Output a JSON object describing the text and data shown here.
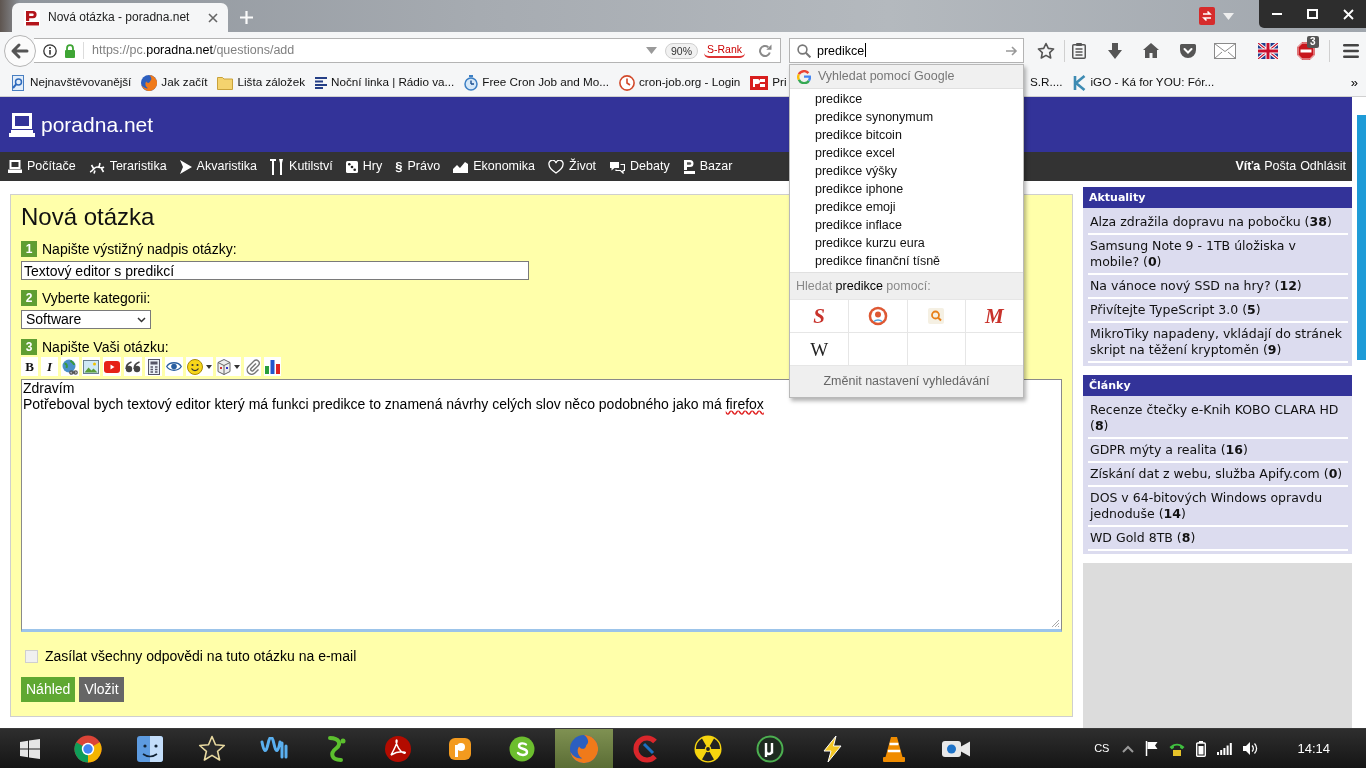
{
  "browser": {
    "tabs": [
      {
        "title": "Nová otázka - poradna.net",
        "selected": true
      }
    ],
    "url": [
      {
        "text": "https://pc.",
        "strong": false
      },
      {
        "text": "poradna.net",
        "strong": true
      },
      {
        "text": "/questions/add",
        "strong": false
      }
    ],
    "zoom": "90%",
    "addon_label": "S-Rank",
    "search_value": "predikce",
    "blocker_badge": "3",
    "bookmarks_left": [
      {
        "label": "Nejnavštěvovanější"
      },
      {
        "label": "Jak začít"
      },
      {
        "label": "Lišta záložek"
      },
      {
        "label": "Noční linka | Rádio va..."
      },
      {
        "label": "Free Cron Job and Mo..."
      },
      {
        "label": "cron-job.org - Login"
      },
      {
        "label": "Pri"
      }
    ],
    "bookmarks_right": [
      {
        "label": "S.R...."
      },
      {
        "label": "iGO - Ká for YOU: Fór..."
      }
    ],
    "bookmarks_overflow": "»"
  },
  "search_dropdown": {
    "header": "Vyhledat pomocí Google",
    "suggestions": [
      "predikce",
      "predikce synonymum",
      "predikce bitcoin",
      "predikce excel",
      "predikce výšky",
      "predikce iphone",
      "predikce emoji",
      "predikce inflace",
      "predikce kurzu eura",
      "predikce finanční tísně"
    ],
    "search_with": [
      {
        "text": "Hledat ",
        "strong": false
      },
      {
        "text": "predikce",
        "strong": true
      },
      {
        "text": " pomocí:",
        "strong": false
      }
    ],
    "engines": [
      {
        "kind": "brush_letter",
        "text": "S",
        "color": "#c8322b"
      },
      {
        "kind": "icon"
      },
      {
        "kind": "icon"
      },
      {
        "kind": "brush_letter",
        "text": "M",
        "color": "#c8322b"
      },
      {
        "kind": "serif_letter",
        "text": "W",
        "color": "#222222"
      }
    ],
    "footer": "Změnit nastavení vyhledávání"
  },
  "site": {
    "logo": "poradna.net",
    "nav": [
      {
        "label": "Počítače"
      },
      {
        "label": "Teraristika"
      },
      {
        "label": "Akvaristika"
      },
      {
        "label": "Kutilství"
      },
      {
        "label": "Hry"
      },
      {
        "label": "Právo",
        "symbol": "§"
      },
      {
        "label": "Ekonomika"
      },
      {
        "label": "Život"
      },
      {
        "label": "Debaty"
      },
      {
        "label": "Bazar"
      }
    ],
    "user": "Víťa",
    "user_links": [
      "Pošta",
      "Odhlásit"
    ]
  },
  "question_form": {
    "title": "Nová otázka",
    "fields": [
      {
        "number": "1",
        "label": "Napište výstižný nadpis otázky:",
        "kind": "text",
        "value": "Textový editor s predikcí"
      },
      {
        "number": "2",
        "label": "Vyberte kategorii:",
        "kind": "select",
        "value": "Software"
      },
      {
        "number": "3",
        "label": "Napište Vaši otázku:",
        "kind": "editor",
        "toolbar": [
          {
            "kind": "bold",
            "text": "B",
            "dropdown": false
          },
          {
            "kind": "italic",
            "text": "I",
            "dropdown": false
          },
          {
            "kind": "icon",
            "dropdown": false
          },
          {
            "kind": "icon",
            "dropdown": false
          },
          {
            "kind": "icon",
            "dropdown": false
          },
          {
            "kind": "icon",
            "dropdown": false
          },
          {
            "kind": "icon",
            "dropdown": false
          },
          {
            "kind": "icon",
            "dropdown": false
          },
          {
            "kind": "icon",
            "dropdown": true
          },
          {
            "kind": "icon",
            "dropdown": true
          },
          {
            "kind": "icon",
            "dropdown": false
          },
          {
            "kind": "icon",
            "dropdown": false
          }
        ],
        "lines": [
          [
            {
              "text": "Zdravím",
              "misspelled": false
            }
          ],
          [
            {
              "text": "Potřeboval bych textový editor který má funkci predikce to znamená návrhy celých slov něco podobného jako má ",
              "misspelled": false
            },
            {
              "text": "firefox",
              "misspelled": true
            }
          ]
        ]
      }
    ],
    "notify": {
      "label": "Zasílat všechny odpovědi na tuto otázku na e-mail",
      "checked": false,
      "disabled": true
    },
    "buttons": [
      {
        "label": "Náhled",
        "kind": "primary"
      },
      {
        "label": "Vložit",
        "kind": "secondary"
      }
    ]
  },
  "sidebar": [
    {
      "title": "Aktuality",
      "items": [
        "Alza zdražila dopravu na pobočku (**38**)",
        "Samsung Note 9 - 1TB úložiska v mobile? (**0**)",
        "Na vánoce nový SSD na hry? (**12**)",
        "Přivítejte TypeScript 3.0 (**5**)",
        "MikroTiky napadeny, vkládají do stránek skript na těžení kryptoměn (**9**)"
      ]
    },
    {
      "title": "Články",
      "items": [
        "Recenze čtečky e-Knih KOBO CLARA HD (**8**)",
        "GDPR mýty a realita (**16**)",
        "Získání dat z webu, služba Apify.com (**0**)",
        "DOS v 64-bitových Windows opravdu jednoduše (**14**)",
        "WD Gold 8TB (**8**)"
      ]
    }
  ],
  "taskbar": {
    "apps": [
      {
        "selected": false
      },
      {
        "selected": false
      },
      {
        "selected": false
      },
      {
        "selected": false
      },
      {
        "selected": false
      },
      {
        "selected": false
      },
      {
        "selected": false
      },
      {
        "selected": false
      },
      {
        "selected": true
      },
      {
        "selected": false
      },
      {
        "selected": false
      },
      {
        "selected": false
      },
      {
        "selected": false
      },
      {
        "selected": false
      },
      {
        "selected": false
      }
    ],
    "language": "CS",
    "clock": "14:14"
  }
}
